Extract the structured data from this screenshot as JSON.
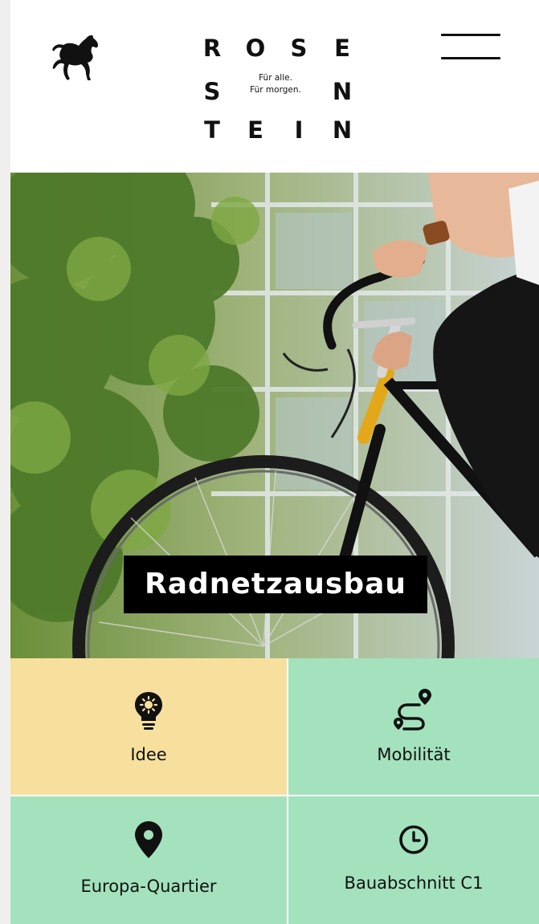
{
  "brand": {
    "logo_letters": [
      "R",
      "O",
      "S",
      "E",
      "S",
      "N",
      "T",
      "E",
      "I",
      "N"
    ],
    "tagline_line1": "Für alle.",
    "tagline_line2": "Für morgen.",
    "crest_icon": "horse-crest-icon",
    "menu_icon": "hamburger-menu-icon"
  },
  "hero": {
    "title": "Radnetzausbau"
  },
  "tiles": [
    {
      "label": "Idee",
      "icon": "lightbulb-icon",
      "color": "#f7e09d"
    },
    {
      "label": "Mobilität",
      "icon": "route-icon",
      "color": "#a3e2bd"
    },
    {
      "label": "Europa-Quartier",
      "icon": "location-pin-icon",
      "color": "#a3e2bd"
    },
    {
      "label": "Bauabschnitt C1",
      "icon": "clock-icon",
      "color": "#a3e2bd"
    }
  ]
}
